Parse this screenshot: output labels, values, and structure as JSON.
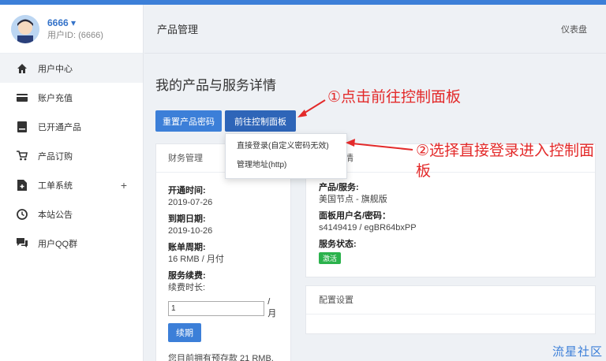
{
  "user": {
    "name": "6666",
    "id_label": "用户ID: (6666)"
  },
  "sidebar": {
    "items": [
      {
        "label": "用户中心",
        "icon": "home-icon",
        "active": true
      },
      {
        "label": "账户充值",
        "icon": "credit-card-icon"
      },
      {
        "label": "已开通产品",
        "icon": "server-icon"
      },
      {
        "label": "产品订购",
        "icon": "cart-icon"
      },
      {
        "label": "工单系统",
        "icon": "ticket-icon",
        "expand": "+"
      },
      {
        "label": "本站公告",
        "icon": "clock-icon"
      },
      {
        "label": "用户QQ群",
        "icon": "chat-icon"
      }
    ]
  },
  "header": {
    "title": "产品管理",
    "dashboard": "仪表盘"
  },
  "main": {
    "section_title": "我的产品与服务详情",
    "reset_button": "重置产品密码",
    "panel_button": "前往控制面板",
    "dropdown": [
      "直接登录(自定义密码无效)",
      "管理地址(http)"
    ]
  },
  "finance": {
    "title": "财务管理",
    "open_label": "开通时间:",
    "open_value": "2019-07-26",
    "expire_label": "到期日期:",
    "expire_value": "2019-10-26",
    "cycle_label": "账单周期:",
    "cycle_value": "16 RMB / 月付",
    "renew_label": "服务续费:",
    "renew_sub": "续费时长:",
    "renew_input": "1",
    "renew_unit": "/月",
    "renew_button": "续期",
    "balance": "您目前拥有预存款 21 RMB,"
  },
  "product": {
    "title_suffix": "情",
    "product_label": "产品/服务:",
    "product_value": "美国节点 - 旗舰版",
    "cred_label": "面板用户名/密码：",
    "cred_value": "s4149419 / egBR64bxPP",
    "status_label": "服务状态:",
    "status_badge": "激活"
  },
  "config": {
    "title": "配置设置"
  },
  "annotations": {
    "step1": "①点击前往控制面板",
    "step2": "②选择直接登录进入控制面板"
  },
  "watermark": "流星社区",
  "colors": {
    "accent": "#3c7fd8",
    "annotation": "#e32a2a",
    "badge": "#2bb24c"
  }
}
